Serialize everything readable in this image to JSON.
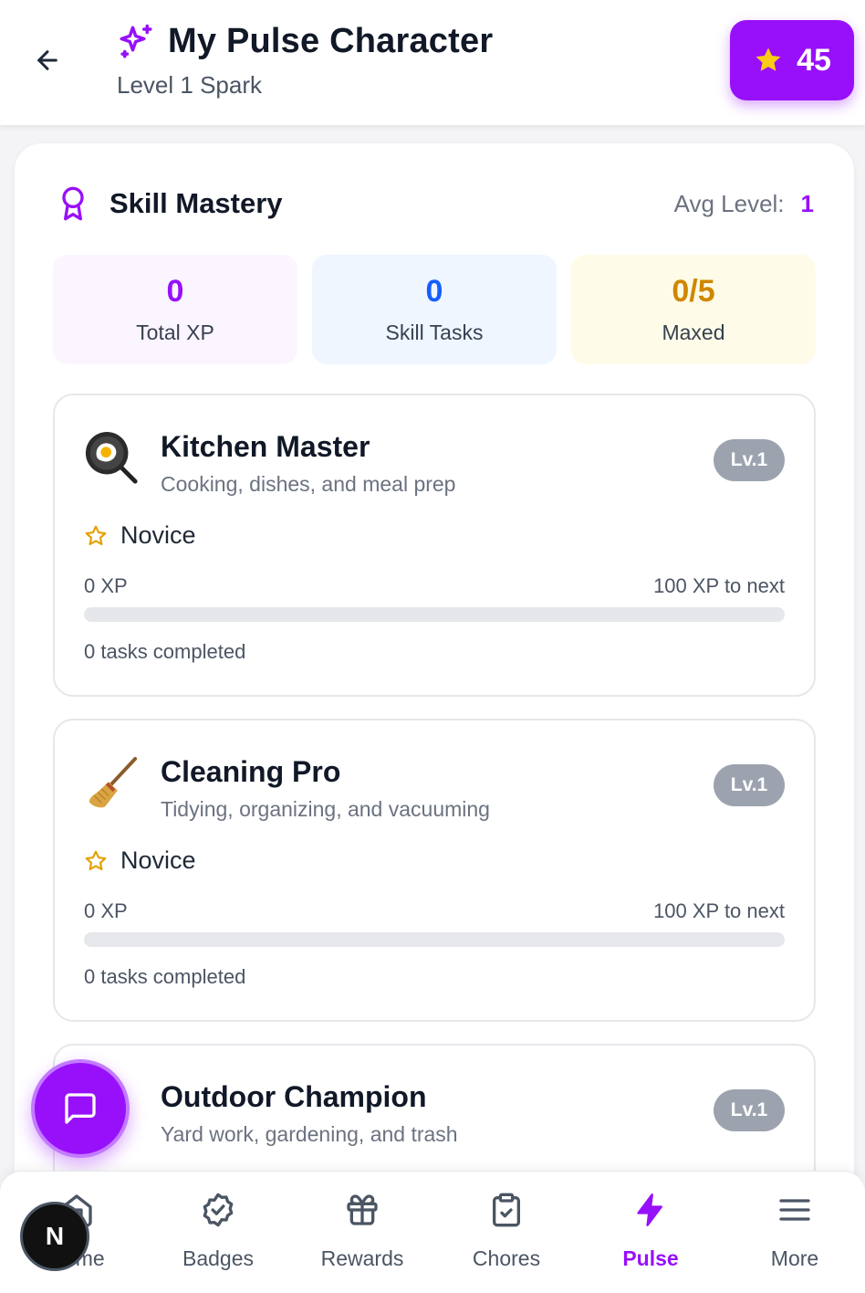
{
  "header": {
    "back_icon": "arrow-left-icon",
    "title_icon": "sparkles-icon",
    "title": "My Pulse Character",
    "subtitle": "Level 1 Spark",
    "points": "45",
    "points_icon": "star-icon"
  },
  "mastery": {
    "icon": "award-icon",
    "title": "Skill Mastery",
    "avg_label": "Avg Level:",
    "avg_value": "1",
    "stats": [
      {
        "value": "0",
        "label": "Total XP",
        "bg": "#faf5ff",
        "color": "#9810fa"
      },
      {
        "value": "0",
        "label": "Skill Tasks",
        "bg": "#eff6ff",
        "color": "#155dfc"
      },
      {
        "value": "0/5",
        "label": "Maxed",
        "bg": "#fefce8",
        "color": "#d08700"
      }
    ]
  },
  "skills": [
    {
      "emoji": "frying-pan-egg-icon",
      "name": "Kitchen Master",
      "description": "Cooking, dishes, and meal prep",
      "level": "Lv.1",
      "rank": "Novice",
      "xp": "0 XP",
      "xp_to_next": "100 XP to next",
      "progress": 0,
      "tasks": "0 tasks completed"
    },
    {
      "emoji": "broom-icon",
      "name": "Cleaning Pro",
      "description": "Tidying, organizing, and vacuuming",
      "level": "Lv.1",
      "rank": "Novice",
      "xp": "0 XP",
      "xp_to_next": "100 XP to next",
      "progress": 0,
      "tasks": "0 tasks completed"
    },
    {
      "emoji": "plant-icon",
      "name": "Outdoor Champion",
      "description": "Yard work, gardening, and trash",
      "level": "Lv.1"
    }
  ],
  "nav": {
    "items": [
      {
        "label": "Home",
        "icon": "home-icon"
      },
      {
        "label": "Badges",
        "icon": "badge-check-icon"
      },
      {
        "label": "Rewards",
        "icon": "gift-icon"
      },
      {
        "label": "Chores",
        "icon": "clipboard-check-icon"
      },
      {
        "label": "Pulse",
        "icon": "zap-icon",
        "active": true
      },
      {
        "label": "More",
        "icon": "menu-icon"
      }
    ]
  },
  "chat_icon": "message-square-icon",
  "avatar": {
    "initial": "N"
  },
  "colors": {
    "accent": "#9810fa",
    "badge_gray": "#9ca3af",
    "star_gold": "#facc15"
  }
}
